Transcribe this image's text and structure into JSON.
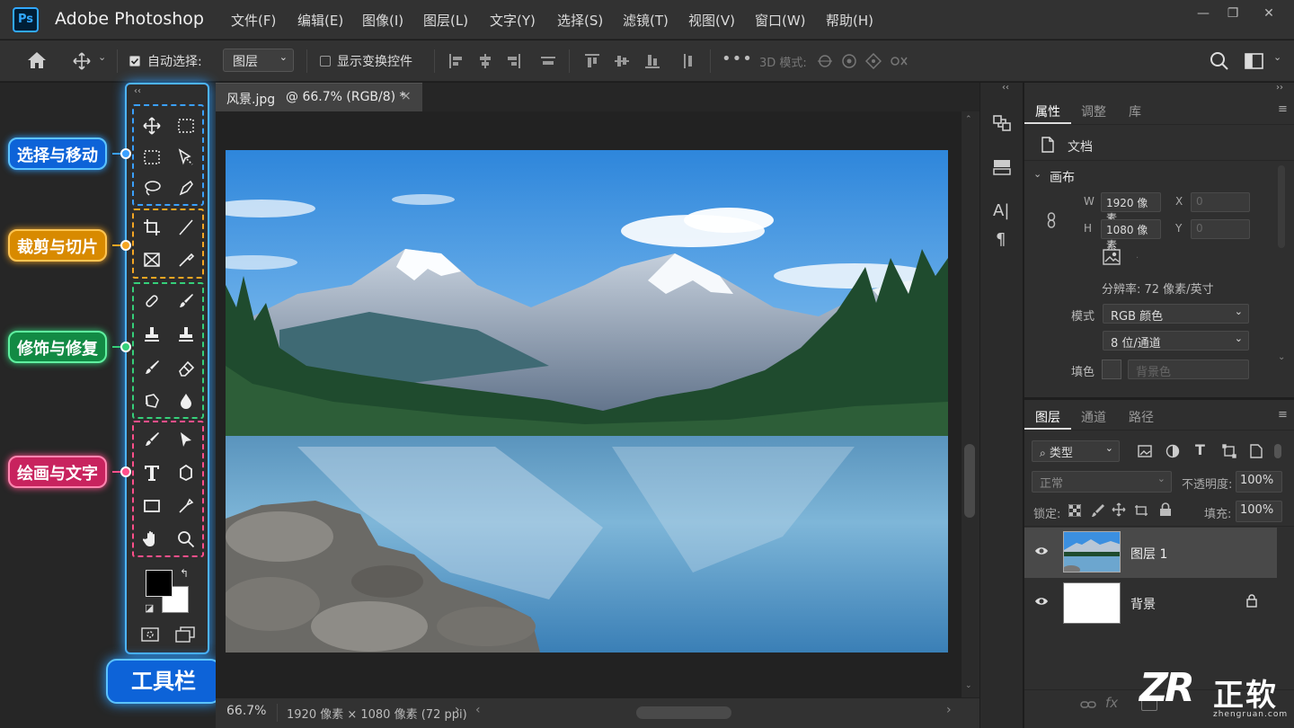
{
  "app": {
    "logo": "Ps",
    "title": "Adobe Photoshop"
  },
  "menu": [
    "文件(F)",
    "编辑(E)",
    "图像(I)",
    "图层(L)",
    "文字(Y)",
    "选择(S)",
    "滤镜(T)",
    "视图(V)",
    "窗口(W)",
    "帮助(H)"
  ],
  "window_controls": {
    "minimize": "—",
    "restore": "❐",
    "close": "✕"
  },
  "options": {
    "auto_select_label": "自动选择:",
    "auto_select_checked": true,
    "layer_dropdown": "图层",
    "show_transform_label": "显示变换控件",
    "mode_3d": "3D 模式:"
  },
  "document": {
    "tab_title": "风景.jpg",
    "tab_info": "@ 66.7% (RGB/8) *",
    "close": "×"
  },
  "status": {
    "zoom": "66.7%",
    "info": "1920 像素 × 1080 像素 (72 ppi)"
  },
  "tool_groups": [
    {
      "label": "选择与移动",
      "color": "#3aa0ff",
      "fill": "#0d63d8"
    },
    {
      "label": "裁剪与切片",
      "color": "#f5a623",
      "fill": "#d88a00"
    },
    {
      "label": "修饰与修复",
      "color": "#35d07a",
      "fill": "#128a44"
    },
    {
      "label": "绘画与文字",
      "color": "#ff4f8b",
      "fill": "#c8235e"
    }
  ],
  "toolbar_label": "工具栏",
  "properties": {
    "tabs": [
      "属性",
      "调整",
      "库"
    ],
    "doc_label": "文档",
    "canvas_section": "画布",
    "w_label": "W",
    "w_value": "1920 像素",
    "h_label": "H",
    "h_value": "1080 像素",
    "x_label": "X",
    "x_value": "0",
    "y_label": "Y",
    "y_value": "0",
    "resolution": "分辨率: 72 像素/英寸",
    "mode_label": "模式",
    "mode_value": "RGB 颜色",
    "depth_value": "8 位/通道",
    "fill_label": "填色",
    "fill_value": "背景色"
  },
  "layers_panel": {
    "tabs": [
      "图层",
      "通道",
      "路径"
    ],
    "filter": "类型",
    "blend": "正常",
    "opacity_label": "不透明度:",
    "opacity_value": "100%",
    "lock_label": "锁定:",
    "fill_label": "填充:",
    "fill_value": "100%",
    "layers": [
      {
        "name": "图层 1"
      },
      {
        "name": "背景"
      }
    ]
  },
  "watermark": {
    "logo": "ZR",
    "text": "正软",
    "url": "zhengruan.com"
  },
  "colors": {
    "accent": "#31a8ff",
    "panel": "#2f2f2f",
    "bar": "#323232"
  }
}
